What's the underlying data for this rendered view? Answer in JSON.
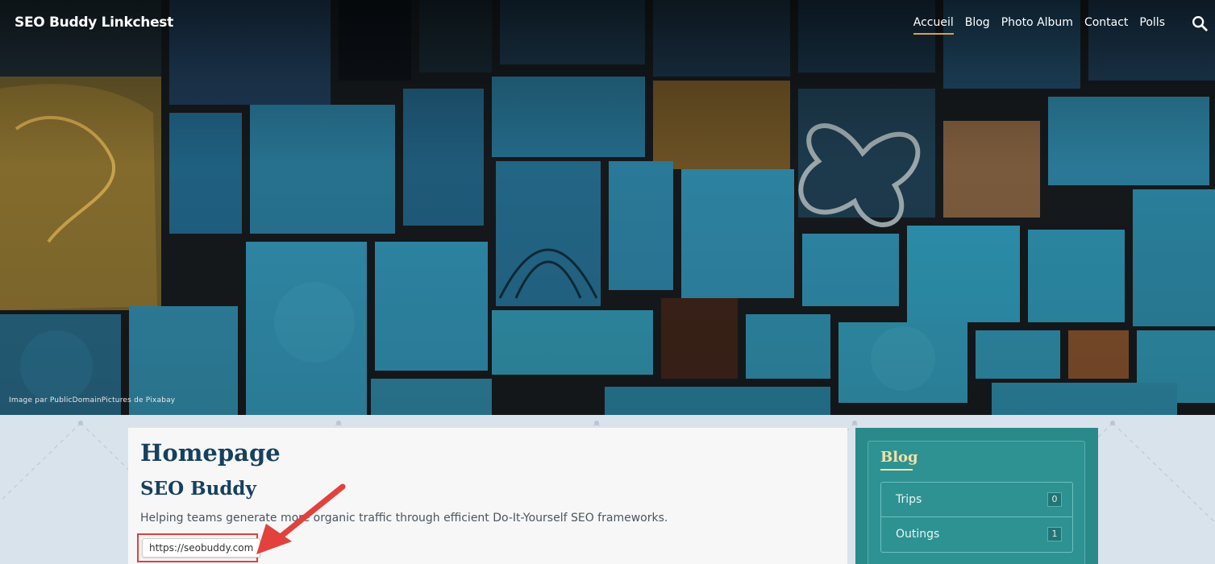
{
  "header": {
    "site_title": "SEO Buddy Linkchest",
    "nav": [
      "Accueil",
      "Blog",
      "Photo Album",
      "Contact",
      "Polls"
    ],
    "active_nav": "Accueil",
    "image_credit": "Image par PublicDomainPictures de Pixabay"
  },
  "main": {
    "title": "Homepage",
    "subtitle": "SEO Buddy",
    "tagline": "Helping teams generate more organic traffic through efficient Do-It-Yourself SEO frameworks.",
    "url": "https://seobuddy.com"
  },
  "sidebar": {
    "widget_title": "Blog",
    "categories": [
      {
        "label": "Trips",
        "count": "0"
      },
      {
        "label": "Outings",
        "count": "1"
      }
    ]
  },
  "colors": {
    "accent": "#d4a63a",
    "title_blue": "#17405f",
    "sidebar_teal": "#2a8a8a",
    "highlight_red": "#e2413c"
  },
  "icons": [
    "search-icon",
    "arrow-annotation-icon"
  ]
}
